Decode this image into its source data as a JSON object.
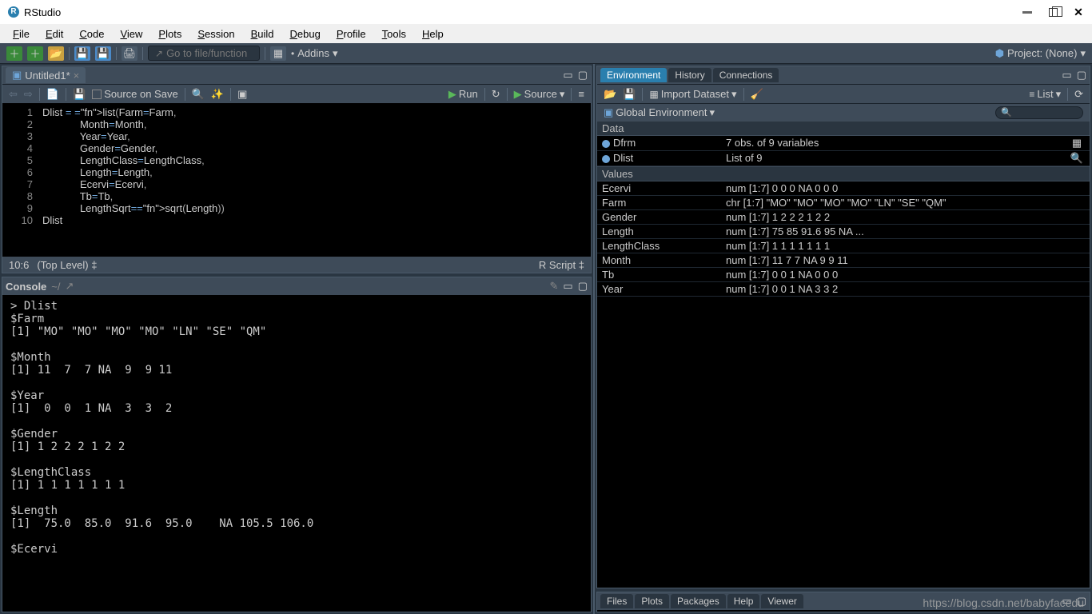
{
  "app": {
    "title": "RStudio"
  },
  "menu": [
    "File",
    "Edit",
    "Code",
    "View",
    "Plots",
    "Session",
    "Build",
    "Debug",
    "Profile",
    "Tools",
    "Help"
  ],
  "toolbar": {
    "goto_placeholder": "Go to file/function",
    "addins": "Addins",
    "project": "Project: (None)"
  },
  "source": {
    "tab": "Untitled1*",
    "source_on_save": "Source on Save",
    "run": "Run",
    "source_btn": "Source",
    "status_pos": "10:6",
    "status_scope": "(Top Level)",
    "status_type": "R Script",
    "lines": [
      "Dlist = list(Farm=Farm,",
      "             Month=Month,",
      "             Year=Year,",
      "             Gender=Gender,",
      "             LengthClass=LengthClass,",
      "             Length=Length,",
      "             Ecervi=Ecervi,",
      "             Tb=Tb,",
      "             LengthSqrt=sqrt(Length))",
      "Dlist"
    ]
  },
  "console": {
    "title": "Console",
    "cwd": "~/",
    "output": "> Dlist\n$Farm\n[1] \"MO\" \"MO\" \"MO\" \"MO\" \"LN\" \"SE\" \"QM\"\n\n$Month\n[1] 11  7  7 NA  9  9 11\n\n$Year\n[1]  0  0  1 NA  3  3  2\n\n$Gender\n[1] 1 2 2 2 1 2 2\n\n$LengthClass\n[1] 1 1 1 1 1 1 1\n\n$Length\n[1]  75.0  85.0  91.6  95.0    NA 105.5 106.0\n\n$Ecervi"
  },
  "env": {
    "tabs": [
      "Environment",
      "History",
      "Connections"
    ],
    "import": "Import Dataset",
    "view": "List",
    "scope": "Global Environment",
    "sections": {
      "Data": [
        {
          "name": "Dfrm",
          "val": "7 obs. of 9 variables",
          "icon": "grid"
        },
        {
          "name": "Dlist",
          "val": "List of 9",
          "icon": "search"
        }
      ],
      "Values": [
        {
          "name": "Ecervi",
          "val": "num [1:7] 0 0 0 NA 0 0 0"
        },
        {
          "name": "Farm",
          "val": "chr [1:7] \"MO\" \"MO\" \"MO\" \"MO\" \"LN\" \"SE\" \"QM\""
        },
        {
          "name": "Gender",
          "val": "num [1:7] 1 2 2 2 1 2 2"
        },
        {
          "name": "Length",
          "val": "num [1:7] 75 85 91.6 95 NA ..."
        },
        {
          "name": "LengthClass",
          "val": "num [1:7] 1 1 1 1 1 1 1"
        },
        {
          "name": "Month",
          "val": "num [1:7] 11 7 7 NA 9 9 11"
        },
        {
          "name": "Tb",
          "val": "num [1:7] 0 0 1 NA 0 0 0"
        },
        {
          "name": "Year",
          "val": "num [1:7] 0 0 1 NA 3 3 2"
        }
      ]
    }
  },
  "bottom_tabs": [
    "Files",
    "Plots",
    "Packages",
    "Help",
    "Viewer"
  ],
  "watermark": "https://blog.csdn.net/babyfacedu"
}
